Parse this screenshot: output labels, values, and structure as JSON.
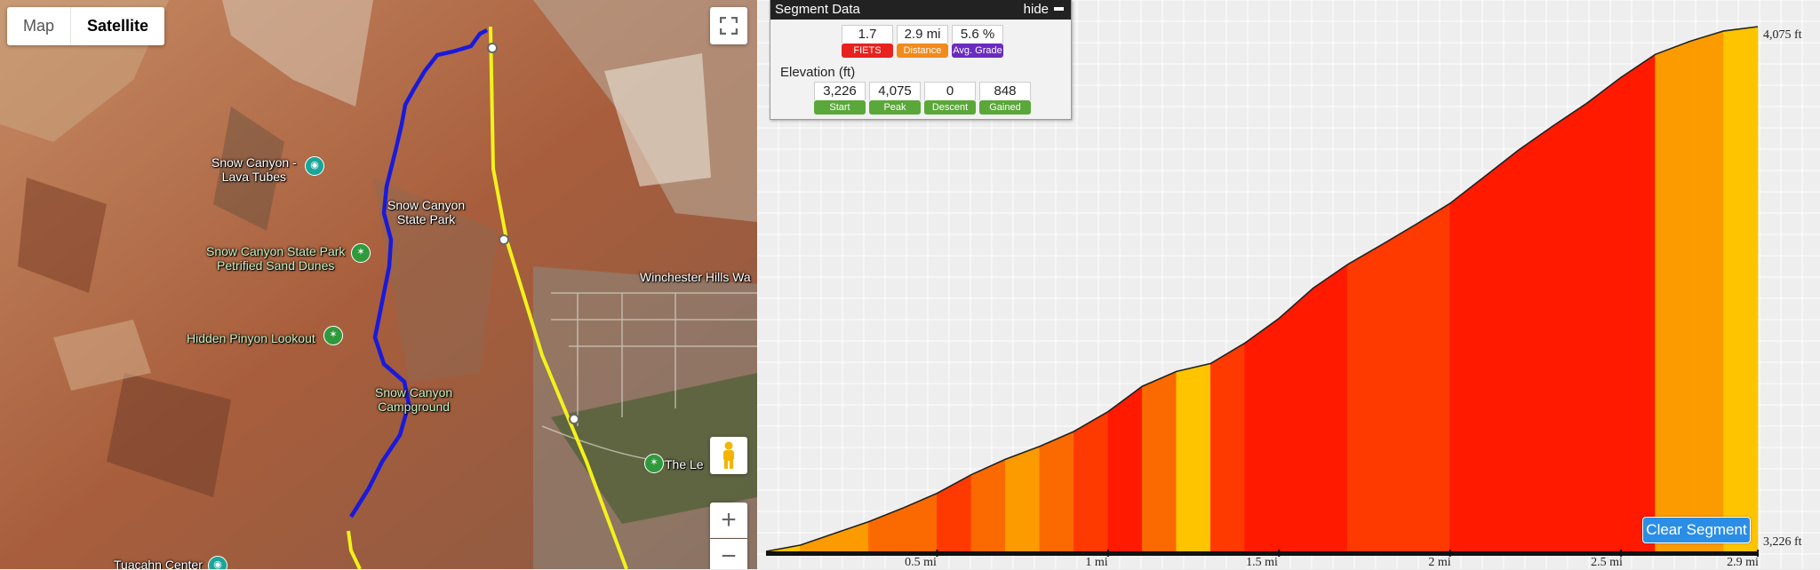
{
  "map": {
    "type_buttons": [
      {
        "label": "Map"
      },
      {
        "label": "Satellite"
      }
    ],
    "active_type": "Satellite",
    "fullscreen_icon": "fullscreen-icon",
    "pegman_icon": "pegman-icon",
    "zoom_in_label": "+",
    "zoom_out_label": "−",
    "places": [
      {
        "name": "Snow Canyon -\nLava Tubes"
      },
      {
        "name": "Snow Canyon\nState Park"
      },
      {
        "name": "Snow Canyon State Park\nPetrified Sand Dunes"
      },
      {
        "name": "Hidden Pinyon Lookout"
      },
      {
        "name": "Snow Canyon\nCampground"
      },
      {
        "name": "Winchester Hills Wa"
      },
      {
        "name": "The Le"
      },
      {
        "name": "Tuacahn Center"
      }
    ],
    "colors": {
      "route": "#1a1adb",
      "road": "#f2f21a"
    }
  },
  "segment": {
    "title": "Segment Data",
    "hide_label": "hide",
    "stats": [
      {
        "value": "1.7",
        "label": "FIETS",
        "color": "red"
      },
      {
        "value": "2.9 mi",
        "label": "Distance",
        "color": "orange"
      },
      {
        "value": "5.6 %",
        "label": "Avg. Grade",
        "color": "purple"
      }
    ],
    "elevation_title": "Elevation (ft)",
    "elevation_stats": [
      {
        "value": "3,226",
        "label": "Start"
      },
      {
        "value": "4,075",
        "label": "Peak"
      },
      {
        "value": "0",
        "label": "Descent"
      },
      {
        "value": "848",
        "label": "Gained"
      }
    ]
  },
  "profile": {
    "max_label": "4,075 ft",
    "min_label": "3,226 ft",
    "distance_labels": [
      "0.5 mi",
      "1 mi",
      "1.5 mi",
      "2 mi",
      "2.5 mi",
      "2.9 mi"
    ],
    "clear_button": "Clear Segment"
  },
  "chart_data": {
    "type": "area",
    "xlabel": "",
    "ylabel": "",
    "x_unit": "mi",
    "y_unit": "ft",
    "xlim": [
      0,
      2.9
    ],
    "ylim": [
      3226,
      4075
    ],
    "x": [
      0,
      0.1,
      0.2,
      0.3,
      0.4,
      0.5,
      0.6,
      0.7,
      0.8,
      0.9,
      1.0,
      1.1,
      1.2,
      1.3,
      1.4,
      1.5,
      1.6,
      1.7,
      1.8,
      1.9,
      2.0,
      2.1,
      2.2,
      2.3,
      2.4,
      2.5,
      2.6,
      2.7,
      2.8,
      2.9
    ],
    "y": [
      3226,
      3236,
      3255,
      3274,
      3296,
      3320,
      3350,
      3375,
      3396,
      3420,
      3452,
      3493,
      3517,
      3530,
      3563,
      3603,
      3652,
      3690,
      3722,
      3755,
      3789,
      3832,
      3875,
      3914,
      3951,
      3993,
      4030,
      4051,
      4068,
      4075
    ],
    "grade_colors": [
      "#fcbf00",
      "#fa6a00",
      "#ff3b00",
      "#ff9d00",
      "#fab600",
      "#ff2e00",
      "#ff1a00",
      "#ff7b00"
    ]
  }
}
